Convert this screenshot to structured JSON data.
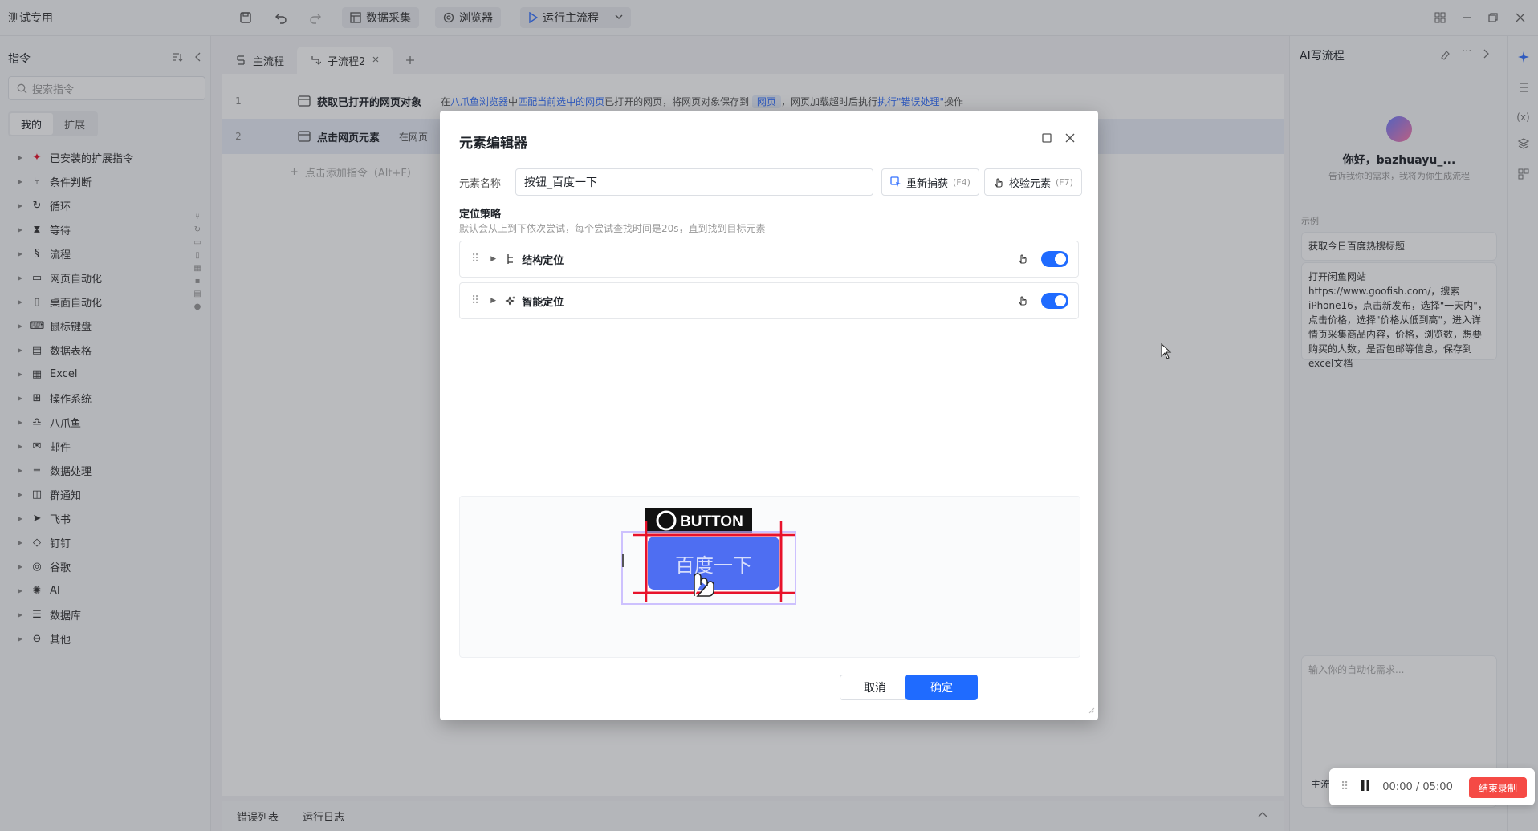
{
  "app": {
    "title": "测试专用"
  },
  "toolbar": {
    "data_collect": "数据采集",
    "browser": "浏览器",
    "run_main": "运行主流程"
  },
  "sidebar": {
    "title": "指令",
    "search_placeholder": "搜索指令",
    "tab_mine": "我的",
    "tab_ext": "扩展",
    "categories": [
      {
        "label": "已安装的扩展指令",
        "icon": "extension-icon"
      },
      {
        "label": "条件判断",
        "icon": "branch-icon"
      },
      {
        "label": "循环",
        "icon": "loop-icon"
      },
      {
        "label": "等待",
        "icon": "hourglass-icon"
      },
      {
        "label": "流程",
        "icon": "flow-icon"
      },
      {
        "label": "网页自动化",
        "icon": "web-icon"
      },
      {
        "label": "桌面自动化",
        "icon": "desktop-icon"
      },
      {
        "label": "鼠标键盘",
        "icon": "keyboard-icon"
      },
      {
        "label": "数据表格",
        "icon": "table-icon"
      },
      {
        "label": "Excel",
        "icon": "excel-icon"
      },
      {
        "label": "操作系统",
        "icon": "os-icon"
      },
      {
        "label": "八爪鱼",
        "icon": "octopus-icon"
      },
      {
        "label": "邮件",
        "icon": "mail-icon"
      },
      {
        "label": "数据处理",
        "icon": "data-process-icon"
      },
      {
        "label": "群通知",
        "icon": "group-notify-icon"
      },
      {
        "label": "飞书",
        "icon": "feishu-icon"
      },
      {
        "label": "钉钉",
        "icon": "dingtalk-icon"
      },
      {
        "label": "谷歌",
        "icon": "google-icon"
      },
      {
        "label": "AI",
        "icon": "ai-icon"
      },
      {
        "label": "数据库",
        "icon": "database-icon"
      },
      {
        "label": "其他",
        "icon": "other-icon"
      }
    ]
  },
  "tabs": {
    "main": "主流程",
    "sub": "子流程2"
  },
  "editor": {
    "lines": [
      {
        "num": "1",
        "cmd": "获取已打开的网页对象",
        "d1": "在",
        "d2": "八爪鱼浏览器",
        "d3": "中",
        "d4": "匹配当前选中的网页",
        "d5": "已打开的网页，将网页对象保存到",
        "d6": "网页",
        "d7": "，网页加载超时后执行",
        "d8": "执行\"错误处理\"",
        "d9": "操作"
      },
      {
        "num": "2",
        "cmd": "点击网页元素",
        "d1": "在网页"
      }
    ],
    "add_hint": "点击添加指令（Alt+F）"
  },
  "bottom": {
    "errors": "错误列表",
    "logs": "运行日志"
  },
  "ai": {
    "title": "AI写流程",
    "greeting": "你好，bazhuayu_...",
    "sub": "告诉我你的需求，我将为你生成流程",
    "examples_label": "示例",
    "example1": "获取今日百度热搜标题",
    "example2": "打开闲鱼网站https://www.goofish.com/，搜索iPhone16，点击新发布，选择\"一天内\"，点击价格，选择\"价格从低到高\"，进入详情页采集商品内容，价格，浏览数，想要购买的人数，是否包邮等信息，保存到excel文档",
    "input_placeholder": "输入你的自动化需求...",
    "bottom_label": "主流"
  },
  "modal": {
    "title": "元素编辑器",
    "name_label": "元素名称",
    "name_value": "按钮_百度一下",
    "recapture": "重新捕获",
    "recapture_key": "(F4)",
    "verify": "校验元素",
    "verify_key": "(F7)",
    "strategy_title": "定位策略",
    "strategy_desc": "默认会从上到下依次尝试，每个尝试查找时间是20s，直到找到目标元素",
    "strategies": [
      "结构定位",
      "智能定位"
    ],
    "preview_tag": "BUTTON",
    "preview_button": "百度一下",
    "cancel": "取消",
    "confirm": "确定"
  },
  "recording": {
    "time": "00:00 / 05:00",
    "stop": "结束录制"
  },
  "colors": {
    "accent": "#1f6bff",
    "stop": "#f54a45",
    "highlight": "#e8132b"
  }
}
